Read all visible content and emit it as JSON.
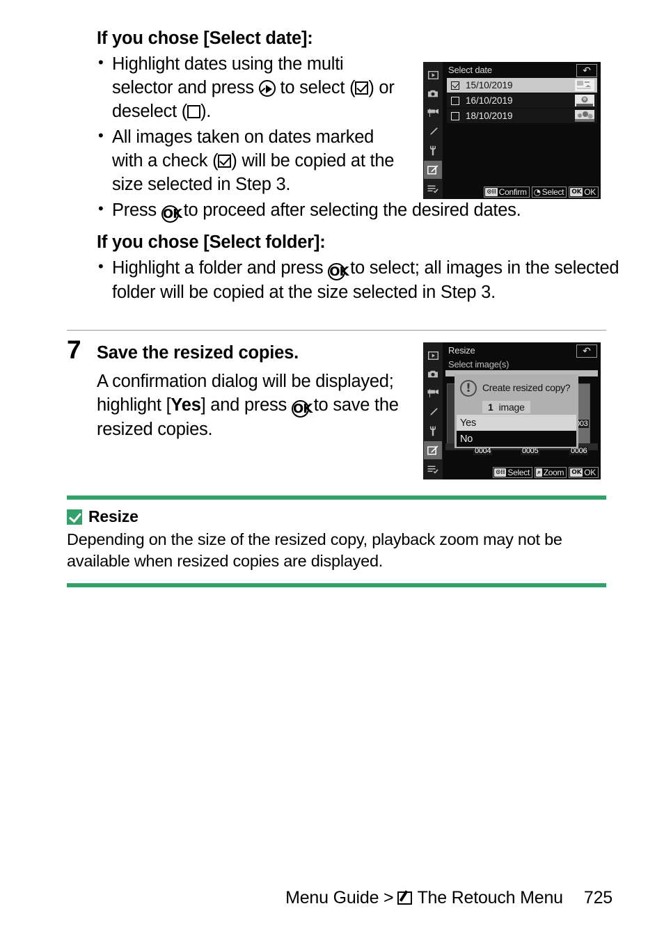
{
  "doc": {
    "page_number": "725",
    "footer_prefix": "Menu Guide >",
    "footer_section": "The Retouch Menu",
    "footer_icon": "retouch-menu-icon",
    "accent_green": "#36a06a"
  },
  "section_date": {
    "heading": "If you chose [Select date]:",
    "bullets": [
      "Highlight dates using the multi selector and press ◉ to select (☑) or deselect (☐).",
      "All images taken on dates marked with a check (☑) will be copied at the size selected in Step 3.",
      "Press ⒪ to proceed after selecting the desired dates."
    ]
  },
  "section_folder": {
    "heading": "If you chose [Select folder]:",
    "bullets": [
      "Highlight a folder and press ⒪ to select; all images in the selected folder will be copied at the size selected in Step 3."
    ]
  },
  "step7": {
    "number": "7",
    "title": "Save the resized copies.",
    "body": "A confirmation dialog will be displayed; highlight [Yes] and press ⒪ to save the resized copies."
  },
  "note": {
    "icon": "checkmark-note-icon",
    "title": "Resize",
    "body": "Depending on the size of the resized copy, playback zoom may not be available when resized copies are displayed."
  },
  "screen_select_date": {
    "title": "Select date",
    "back_label": "↶",
    "menu_rail": [
      {
        "name": "playback-menu-icon",
        "selected": false
      },
      {
        "name": "photo-shooting-menu-icon",
        "selected": false
      },
      {
        "name": "movie-shooting-menu-icon",
        "selected": false
      },
      {
        "name": "custom-settings-menu-icon",
        "selected": false
      },
      {
        "name": "setup-menu-icon",
        "selected": false
      },
      {
        "name": "retouch-menu-icon",
        "selected": true
      },
      {
        "name": "my-menu-icon",
        "selected": false
      }
    ],
    "rows": [
      {
        "date": "15/10/2019",
        "checked": true,
        "highlighted": true
      },
      {
        "date": "16/10/2019",
        "checked": false,
        "highlighted": false
      },
      {
        "date": "18/10/2019",
        "checked": false,
        "highlighted": false
      }
    ],
    "toolbar": [
      {
        "glyph": "⊙⋮⋮",
        "label": "Confirm"
      },
      {
        "glyph": "◔",
        "label": "Select"
      },
      {
        "glyph": "OK",
        "label": "OK"
      }
    ]
  },
  "screen_resize": {
    "title": "Resize",
    "subtitle": "Select image(s)",
    "back_label": "↶",
    "menu_rail": [
      {
        "name": "playback-menu-icon",
        "selected": false
      },
      {
        "name": "photo-shooting-menu-icon",
        "selected": false
      },
      {
        "name": "movie-shooting-menu-icon",
        "selected": false
      },
      {
        "name": "custom-settings-menu-icon",
        "selected": false
      },
      {
        "name": "setup-menu-icon",
        "selected": false
      },
      {
        "name": "retouch-menu-icon",
        "selected": true
      },
      {
        "name": "my-menu-icon",
        "selected": false
      }
    ],
    "thumbnails": [
      "0004",
      "0005",
      "0006",
      "003"
    ],
    "dialog": {
      "icon": "warning-icon",
      "question": "Create resized copy?",
      "count": "1",
      "count_unit": "image",
      "options": [
        {
          "label": "Yes",
          "highlighted": true
        },
        {
          "label": "No",
          "highlighted": false
        }
      ]
    },
    "toolbar": [
      {
        "glyph": "⊙⋮⋮",
        "label": "Select"
      },
      {
        "glyph": "⌕",
        "label": "Zoom"
      },
      {
        "glyph": "OK",
        "label": "OK"
      }
    ]
  }
}
